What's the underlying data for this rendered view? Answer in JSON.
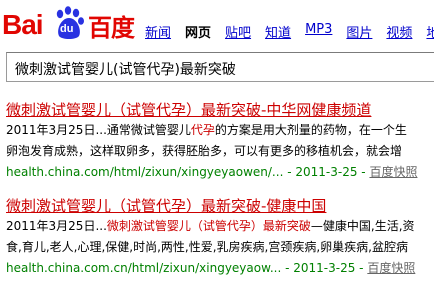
{
  "logo": {
    "bai": "Bai",
    "du": "du",
    "cn": "百度"
  },
  "nav": {
    "items": [
      {
        "label": "新闻",
        "active": false
      },
      {
        "label": "网页",
        "active": true
      },
      {
        "label": "贴吧",
        "active": false
      },
      {
        "label": "知道",
        "active": false
      },
      {
        "label": "MP3",
        "active": false
      },
      {
        "label": "图片",
        "active": false
      },
      {
        "label": "视频",
        "active": false
      },
      {
        "label": "地",
        "active": false
      }
    ]
  },
  "search": {
    "value": "微刺激试管婴儿(试管代孕)最新突破"
  },
  "results": [
    {
      "title_hl": "微刺激试管婴儿（试管代孕）最新突破",
      "title_rest": "-中华网健康频道",
      "line1_pre": "2011年3月25日...通常微试管婴儿",
      "line1_hl": "代孕",
      "line1_post": "的方案是用大剂量的药物，在一个生",
      "line2": "卵泡发育成熟，这样取卵多，获得胚胎多，可以有更多的移植机会，就会增",
      "url": "health.china.com/html/zixun/xingyeyaowen/...",
      "date": "2011-3-25",
      "sep": " - ",
      "cache": "百度快照"
    },
    {
      "title_hl": "微刺激试管婴儿（试管代孕）最新突破",
      "title_rest": "-健康中国",
      "line1_pre": "2011年3月25日...",
      "line1_hl": "微刺激试管婴儿（试管代孕）最新突破",
      "line1_post": "—健康中国,生活,资",
      "line2": "食,育儿,老人,心理,保健,时尚,两性,性爱,乳房疾病,宫颈疾病,卵巢疾病,盆腔病",
      "url": "health.china.com.cn/html/zixun/xingyeyaow...",
      "date": "2011-3-25",
      "sep": " - ",
      "cache": "百度快照"
    }
  ],
  "colors": {
    "brand_red": "#e10602",
    "brand_blue": "#2932e1",
    "link": "#0000cc",
    "url_green": "#008000"
  }
}
